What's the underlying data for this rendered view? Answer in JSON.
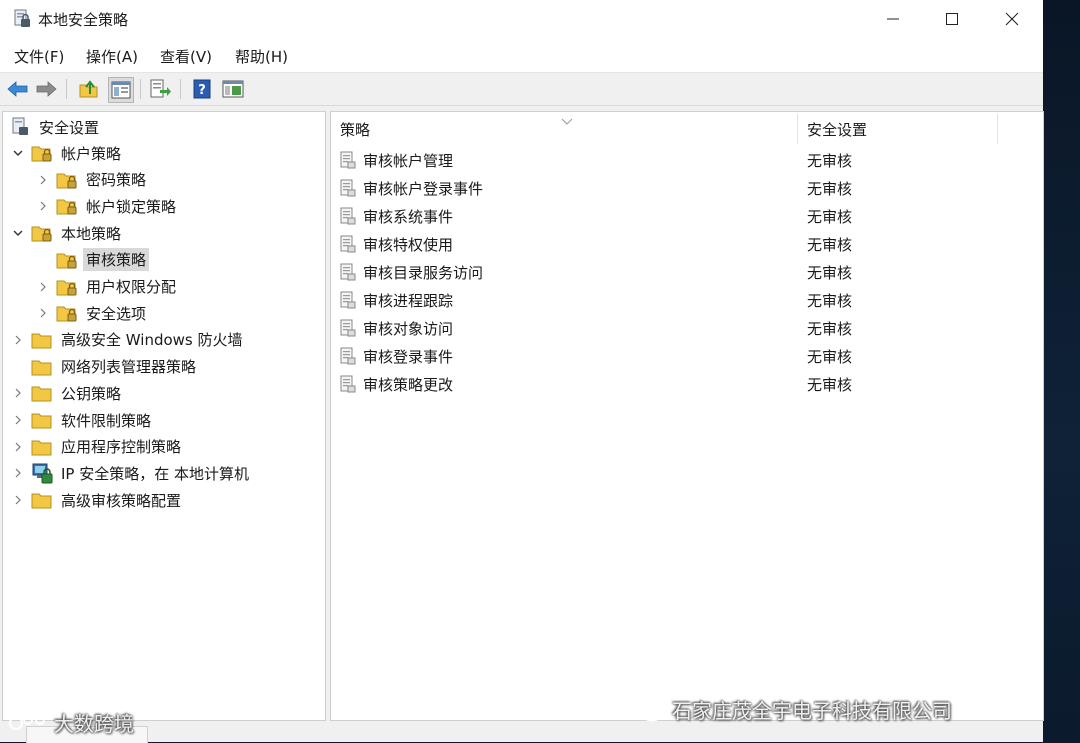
{
  "window": {
    "title": "本地安全策略"
  },
  "menu": [
    {
      "label": "文件(F)"
    },
    {
      "label": "操作(A)"
    },
    {
      "label": "查看(V)"
    },
    {
      "label": "帮助(H)"
    }
  ],
  "toolbar": {
    "icons": [
      "back-arrow-icon",
      "forward-arrow-icon",
      "up-folder-icon",
      "show-hide-tree-icon",
      "export-list-icon",
      "help-icon",
      "console-icon"
    ]
  },
  "tree": {
    "root": "安全设置",
    "items": [
      {
        "label": "帐户策略",
        "expanded": true
      },
      {
        "label": "密码策略"
      },
      {
        "label": "帐户锁定策略"
      },
      {
        "label": "本地策略",
        "expanded": true
      },
      {
        "label": "审核策略",
        "selected": true
      },
      {
        "label": "用户权限分配"
      },
      {
        "label": "安全选项"
      },
      {
        "label": "高级安全 Windows 防火墙"
      },
      {
        "label": "网络列表管理器策略"
      },
      {
        "label": "公钥策略"
      },
      {
        "label": "软件限制策略"
      },
      {
        "label": "应用程序控制策略"
      },
      {
        "label": "IP 安全策略，在 本地计算机"
      },
      {
        "label": "高级审核策略配置"
      }
    ]
  },
  "list": {
    "columns": [
      "策略",
      "安全设置"
    ],
    "rows": [
      {
        "policy": "审核帐户管理",
        "setting": "无审核"
      },
      {
        "policy": "审核帐户登录事件",
        "setting": "无审核"
      },
      {
        "policy": "审核系统事件",
        "setting": "无审核"
      },
      {
        "policy": "审核特权使用",
        "setting": "无审核"
      },
      {
        "policy": "审核目录服务访问",
        "setting": "无审核"
      },
      {
        "policy": "审核进程跟踪",
        "setting": "无审核"
      },
      {
        "policy": "审核对象访问",
        "setting": "无审核"
      },
      {
        "policy": "审核登录事件",
        "setting": "无审核"
      },
      {
        "policy": "审核策略更改",
        "setting": "无审核"
      }
    ]
  },
  "watermarks": {
    "left": "大数跨境",
    "right": "石家庄茂全宇电子科技有限公司"
  },
  "colors": {
    "folder": "#f2c744",
    "back_arrow": "#3b8ad8",
    "selected_bg": "#d9d9d9"
  }
}
